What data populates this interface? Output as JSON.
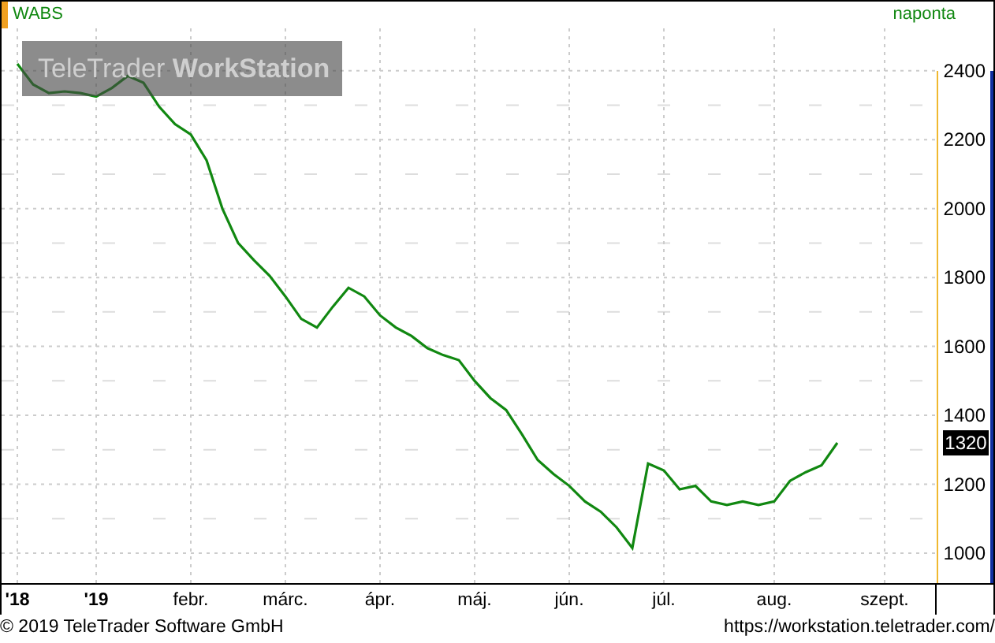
{
  "header": {
    "interval": "naponta"
  },
  "watermark": "TeleTrader **WorkStation**",
  "chart": {
    "last_price_label": "1320",
    "chart_data": {
      "type": "line",
      "grid": true,
      "ylim": [
        913,
        2523
      ],
      "yticks": [
        1000,
        1200,
        1400,
        1600,
        1800,
        2000,
        2200,
        2400
      ],
      "categories": [
        "'18",
        null,
        null,
        null,
        null,
        "'19",
        null,
        null,
        null,
        null,
        null,
        "febr.",
        null,
        null,
        null,
        null,
        null,
        "márc.",
        null,
        null,
        null,
        null,
        null,
        "ápr.",
        null,
        null,
        null,
        null,
        null,
        "máj.",
        null,
        null,
        null,
        null,
        null,
        "jún.",
        null,
        null,
        null,
        null,
        null,
        "júl.",
        null,
        null,
        null,
        null,
        null,
        null,
        "aug.",
        null,
        null,
        null,
        null,
        null,
        null,
        "szept.",
        null,
        null
      ],
      "series": [
        {
          "name": "WABS",
          "color": "#118811",
          "values": [
            2420,
            2360,
            2335,
            2340,
            2335,
            2325,
            2350,
            2385,
            2365,
            2295,
            2245,
            2215,
            2140,
            2000,
            1900,
            1850,
            1805,
            1745,
            1680,
            1655,
            1715,
            1770,
            1745,
            1690,
            1655,
            1630,
            1595,
            1575,
            1560,
            1500,
            1450,
            1415,
            1345,
            1270,
            1230,
            1195,
            1150,
            1120,
            1075,
            1015,
            1260,
            1240,
            1185,
            1195,
            1150,
            1140,
            1150,
            1140,
            1150,
            1210,
            1235,
            1255,
            1320,
            null,
            null,
            null,
            null,
            null
          ]
        }
      ]
    }
  },
  "footer": {
    "copyright": "© 2019 TeleTrader Software GmbH",
    "url": "https://workstation.teletrader.com/"
  }
}
